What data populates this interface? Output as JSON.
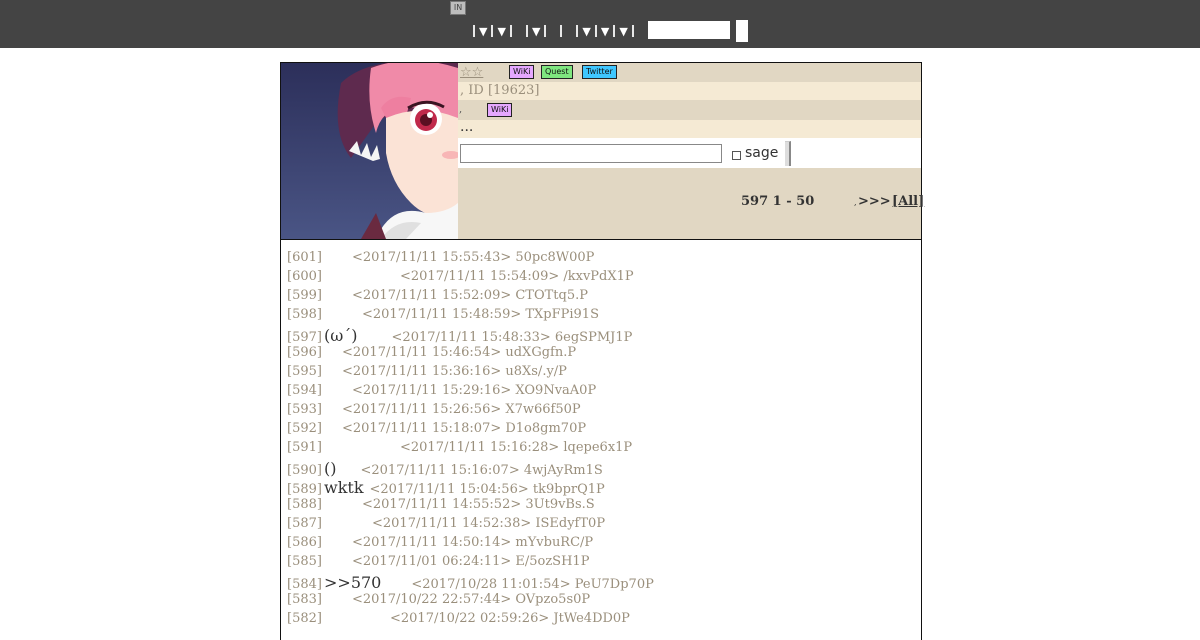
{
  "topbar": {
    "logo_text": "IN",
    "search": {
      "value": "",
      "placeholder": ""
    }
  },
  "header": {
    "stars": "☆☆",
    "badges": {
      "wiki": "WiKi",
      "quest": "Quest",
      "twitter": "Twitter",
      "wiki2": "WiKi"
    },
    "thread_id": ", ID [19623]",
    "small_dot": ",",
    "ellipsis": "...",
    "sage_label": "sage",
    "res_count": "597  1  - 50",
    "nav_dot": ",",
    "nav_next": ">>>",
    "nav_all": "[All]"
  },
  "posts": [
    {
      "num": "[601]",
      "name": "",
      "gap": 28,
      "meta": "<2017/11/11 15:55:43> 50pc8W00P"
    },
    {
      "num": "[600]",
      "name": "",
      "gap": 76,
      "meta": "<2017/11/11 15:54:09> /kxvPdX1P"
    },
    {
      "num": "[599]",
      "name": "",
      "gap": 28,
      "meta": "<2017/11/11 15:52:09> CTOTtq5.P"
    },
    {
      "num": "[598]",
      "name": "",
      "gap": 38,
      "meta": "<2017/11/11 15:48:59> TXpFPi91S"
    },
    {
      "num": "[597]",
      "name": "(ω´)",
      "gap": 34,
      "meta": "<2017/11/11 15:48:33> 6egSPMJ1P"
    },
    {
      "num": "[596]",
      "name": "",
      "gap": 18,
      "meta": "<2017/11/11 15:46:54> udXGgfn.P"
    },
    {
      "num": "[595]",
      "name": "",
      "gap": 18,
      "meta": "<2017/11/11 15:36:16> u8Xs/.y/P"
    },
    {
      "num": "[594]",
      "name": "",
      "gap": 28,
      "meta": "<2017/11/11 15:29:16> XO9NvaA0P"
    },
    {
      "num": "[593]",
      "name": "",
      "gap": 18,
      "meta": "<2017/11/11 15:26:56> X7w66f50P"
    },
    {
      "num": "[592]",
      "name": "",
      "gap": 18,
      "meta": "<2017/11/11 15:18:07> D1o8gm70P"
    },
    {
      "num": "[591]",
      "name": "",
      "gap": 76,
      "meta": "<2017/11/11 15:16:28> lqepe6x1P"
    },
    {
      "num": "[590]",
      "name": "()",
      "gap": 24,
      "meta": "<2017/11/11 15:16:07> 4wjAyRm1S"
    },
    {
      "num": "[589]",
      "name": "wktk",
      "gap": 6,
      "meta": "<2017/11/11 15:04:56> tk9bprQ1P"
    },
    {
      "num": "[588]",
      "name": "",
      "gap": 38,
      "meta": "<2017/11/11 14:55:52> 3Ut9vBs.S"
    },
    {
      "num": "[587]",
      "name": "",
      "gap": 48,
      "meta": "<2017/11/11 14:52:38> ISEdyfT0P"
    },
    {
      "num": "[586]",
      "name": "",
      "gap": 28,
      "meta": "<2017/11/11 14:50:14> mYvbuRC/P"
    },
    {
      "num": "[585]",
      "name": "",
      "gap": 28,
      "meta": "<2017/11/01 06:24:11> E/5ozSH1P"
    },
    {
      "num": "[584]",
      "name": ">>570",
      "gap": 30,
      "meta": "<2017/10/28 11:01:54> PeU7Dp70P"
    },
    {
      "num": "[583]",
      "name": "",
      "gap": 28,
      "meta": "<2017/10/22 22:57:44> OVpzo5s0P"
    },
    {
      "num": "[582]",
      "name": "",
      "gap": 66,
      "meta": "<2017/10/22 02:59:26> JtWe4DD0P"
    }
  ]
}
